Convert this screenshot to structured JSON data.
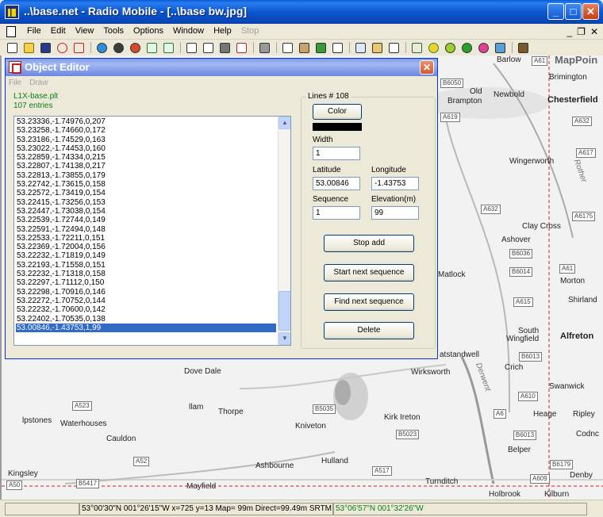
{
  "window": {
    "title": "..\\base.net - Radio Mobile - [..\\base bw.jpg]",
    "min": "_",
    "max": "□",
    "close": "✕"
  },
  "menu": {
    "items": [
      "File",
      "Edit",
      "View",
      "Tools",
      "Options",
      "Window",
      "Help"
    ],
    "disabled": "Stop",
    "mdi_min": "_",
    "mdi_restore": "❐",
    "mdi_close": "✕"
  },
  "map_labels": {
    "places": [
      "Barlow",
      "MapPoin",
      "Brimington",
      "Old",
      "Newbold",
      "Brampton",
      "Chesterfield",
      "Wingerworth",
      "Clay Cross",
      "Ashover",
      "Matlock",
      "Morton",
      "Shirland",
      "South",
      "Wingfield",
      "Alfreton",
      "atstandwell",
      "Crich",
      "Wirksworth",
      "Swanwick",
      "Dove Dale",
      "llam",
      "Thorpe",
      "Kirk Ireton",
      "Heage",
      "Ripley",
      "lpstones",
      "Waterhouses",
      "Kniveton",
      "Codnc",
      "Cauldon",
      "Belper",
      "Hulland",
      "Ashbourne",
      "Kingsley",
      "Mayfield",
      "Turnditch",
      "Denby",
      "Holbrook",
      "Kilburn",
      "Rother",
      "Derwent"
    ],
    "roads": [
      "A61",
      "B6050",
      "A619",
      "A632",
      "A617",
      "A632",
      "A6175",
      "B6036",
      "B6014",
      "A61",
      "A615",
      "B6013",
      "A610",
      "A6",
      "B6013",
      "B6179",
      "A523",
      "B5035",
      "B5023",
      "A52",
      "A517",
      "A609",
      "B5417",
      "A50"
    ]
  },
  "status": {
    "cells": [
      "53°00'30\"N  001°26'15\"W  x=725 y=13  Map= 99m  Direct=99.49m  SRTM",
      "53°06'57\"N 001°32'26\"W"
    ]
  },
  "dialog": {
    "title": "Object Editor",
    "close": "✕",
    "menu_file": "File",
    "menu_draw": "Draw",
    "filename": "L1X-base.plt",
    "entries": "107 entries",
    "rows": [
      "53.23336,-1.74976,0,207",
      "53.23258,-1.74660,0,172",
      "53.23186,-1.74529,0,163",
      "53.23022,-1.74453,0,160",
      "53.22859,-1.74334,0,215",
      "53.22807,-1.74138,0,217",
      "53.22813,-1.73855,0,179",
      "53.22742,-1.73615,0,158",
      "53.22572,-1.73419,0,154",
      "53.22415,-1.73256,0,153",
      "53.22447,-1.73038,0,154",
      "53.22539,-1.72744,0,149",
      "53.22591,-1.72494,0,148",
      "53.22533,-1.72211,0,151",
      "53.22369,-1.72004,0,156",
      "53.22232,-1.71819,0,149",
      "53.22193,-1.71558,0,151",
      "53.22232,-1.71318,0,158",
      "53.22297,-1.71112,0,150",
      "53.22298,-1.70916,0,146",
      "53.22272,-1.70752,0,144",
      "53.22232,-1.70600,0,142",
      "53.22402,-1.70535,0,138",
      "53.00846,-1.43753,1,99"
    ],
    "selected_row": "53.00846,-1.43753,1,99",
    "group_title": "Lines # 108",
    "color_button": "Color",
    "color_value": "#000000",
    "width_label": "Width",
    "width_value": "1",
    "latitude_label": "Latitude",
    "latitude_value": "53.00846",
    "longitude_label": "Longitude",
    "longitude_value": "-1.43753",
    "sequence_label": "Sequence",
    "sequence_value": "1",
    "elevation_label": "Elevation(m)",
    "elevation_value": "99",
    "stop_add": "Stop add",
    "start_next": "Start next sequence",
    "find_next": "Find next sequence",
    "delete": "Delete"
  },
  "icons": [
    "new-file-icon",
    "open-folder-icon",
    "save-icon",
    "network-icon",
    "units-icon",
    "globe-icon",
    "properties-icon",
    "zoom-icon",
    "first-icon",
    "last-icon",
    "window-icon",
    "map-icon",
    "picture-icon",
    "print-icon",
    "copy-icon",
    "paste-icon",
    "coverage-icon",
    "antenna-icon",
    "radio-link-icon",
    "polar-icon",
    "signal-icon",
    "tower-icon",
    "camera-icon",
    "exit-icon"
  ]
}
